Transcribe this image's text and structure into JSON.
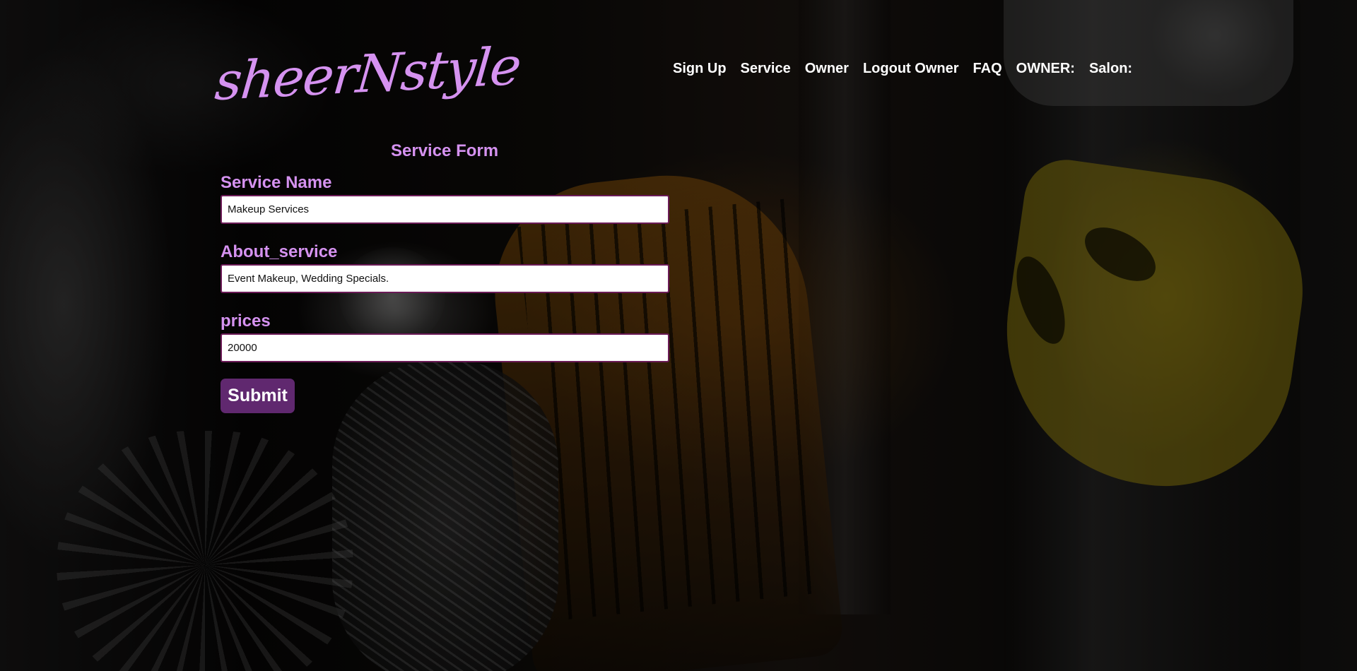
{
  "brand": {
    "logo_text": "sheerNstyle"
  },
  "nav": {
    "items": [
      "Sign Up",
      "Service",
      "Owner",
      "Logout Owner",
      "FAQ",
      "OWNER:",
      "Salon:"
    ]
  },
  "form": {
    "title": "Service Form",
    "fields": [
      {
        "label": "Service Name",
        "value": "Makeup Services"
      },
      {
        "label": "About_service",
        "value": "Event Makeup, Wedding Specials."
      },
      {
        "label": "prices",
        "value": "20000"
      }
    ],
    "submit_label": "Submit"
  },
  "colors": {
    "accent": "#d592f0",
    "button": "#60286f",
    "input_border": "#6b1b57"
  }
}
